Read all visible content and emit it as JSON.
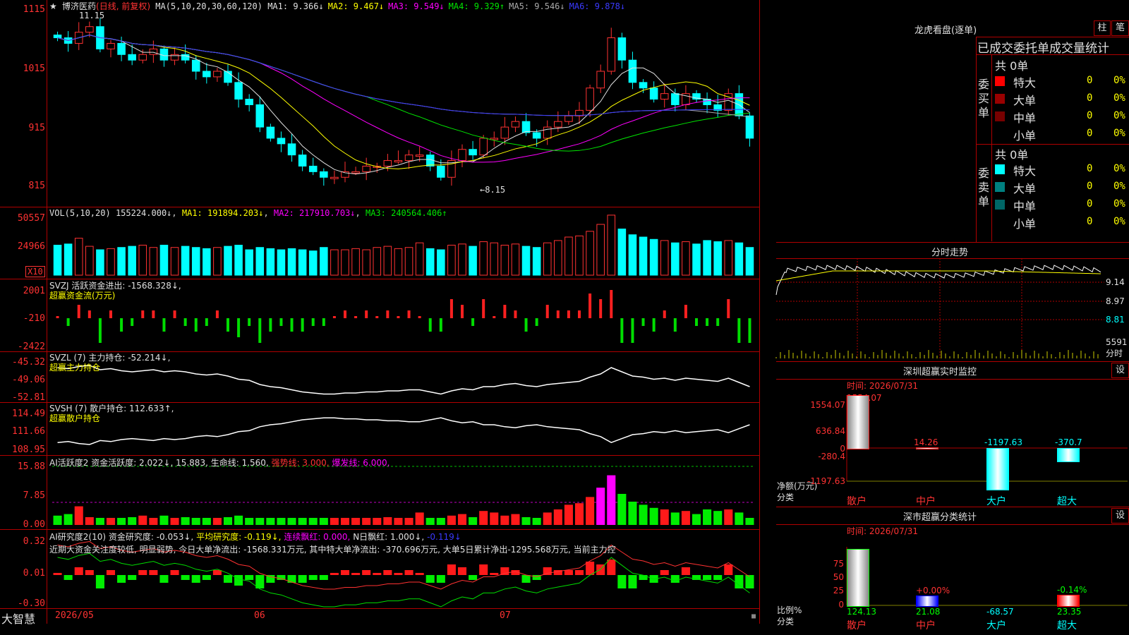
{
  "stock_header": {
    "star": "★",
    "name": "博济医药",
    "mode": "(日线, 前复权)",
    "ma_label": "MA(5,10,20,30,60,120)",
    "ma": [
      {
        "label": "MA1:",
        "val": "9.366",
        "dir": "↓",
        "color": "#e0e0e0"
      },
      {
        "label": "MA2:",
        "val": "9.467",
        "dir": "↓",
        "color": "#ffff00"
      },
      {
        "label": "MA3:",
        "val": "9.549",
        "dir": "↓",
        "color": "#ff00ff"
      },
      {
        "label": "MA4:",
        "val": "9.329",
        "dir": "↑",
        "color": "#00e600"
      },
      {
        "label": "MA5:",
        "val": "9.546",
        "dir": "↓",
        "color": "#aaaaaa"
      },
      {
        "label": "MA6:",
        "val": "9.878",
        "dir": "↓",
        "color": "#3a3aff"
      }
    ]
  },
  "price_axis": [
    "1115",
    "1015",
    "915",
    "815"
  ],
  "high_label": "11.15",
  "low_label": "←8.15",
  "vol": {
    "head": "VOL(5,10,20)",
    "v": "155224.000↓",
    "ma1": "MA1: 191894.203↓",
    "ma2": "MA2: 217910.703↓",
    "ma3": "MA3: 240564.406↑",
    "axis": [
      "50557",
      "24966"
    ],
    "unit": "X10"
  },
  "svzj": {
    "head": "SVZJ  活跃资金进出: -1568.328↓,",
    "sub": "超赢资金流(万元)",
    "axis": [
      "2001",
      "-210",
      "-2422"
    ]
  },
  "svzl": {
    "head": "SVZL (7) 主力持仓: -52.214↓,",
    "sub": "超赢主力持仓",
    "axis": [
      "-45.32",
      "-49.06",
      "-52.81"
    ]
  },
  "svsh": {
    "head": "SVSH (7) 散户持仓: 112.633↑,",
    "sub": "超赢散户持仓",
    "axis": [
      "114.49",
      "111.66",
      "108.95"
    ]
  },
  "ai2": {
    "head": "AI活跃度2 资金活跃度: 2.022↓, 15.883, 生命线: 1.560,",
    "strong": "强势线: 3.000,",
    "burst": "爆发线: 6.000,",
    "axis": [
      "15.88",
      "7.85",
      "0.00"
    ]
  },
  "ai3": {
    "head": "AI研究度2(10) 资金研究度: -0.053↓,",
    "avg": "平均研究度: -0.119↓,",
    "lx": "连续飘红: 0.000,",
    "nr": "N日飘红: 1.000↓,",
    "last": "-0.119↓",
    "axis": [
      "0.32",
      "0.01",
      "-0.30"
    ],
    "comment": "近期大资金关注度较低, 明显弱势, 今日大单净流出: -1568.331万元, 其中特大单净流出: -370.696万元, 大单5日累计净出-1295.568万元, 当前主力控"
  },
  "bottom": {
    "brand": "大智慧",
    "dates": [
      "2026/05",
      "06",
      "07"
    ]
  },
  "lhb": {
    "title": "龙虎看盘(逐单)",
    "btn1": "柱",
    "btn2": "笔",
    "tab": "已成交委托单成交量统计",
    "buy": {
      "side": "委买单",
      "total": "共 0单",
      "rows": [
        {
          "name": "特大",
          "v": "0",
          "p": "0%",
          "c": "#ff0000"
        },
        {
          "name": "大单",
          "v": "0",
          "p": "0%",
          "c": "#990000"
        },
        {
          "name": "中单",
          "v": "0",
          "p": "0%",
          "c": "#770000"
        },
        {
          "name": "小单",
          "v": "0",
          "p": "0%",
          "c": "#000000"
        }
      ]
    },
    "sell": {
      "side": "委卖单",
      "total": "共 0单",
      "rows": [
        {
          "name": "特大",
          "v": "0",
          "p": "0%",
          "c": "#00ffff"
        },
        {
          "name": "大单",
          "v": "0",
          "p": "0%",
          "c": "#008080"
        },
        {
          "name": "中单",
          "v": "0",
          "p": "0%",
          "c": "#006666"
        },
        {
          "name": "小单",
          "v": "0",
          "p": "0%",
          "c": "#000000"
        }
      ]
    }
  },
  "fenshi": {
    "title": "分时走势",
    "axis": [
      "9.14",
      "8.97",
      "8.81"
    ],
    "vol": "5591",
    "vlabel": "分时"
  },
  "monitor": {
    "title": "深圳超赢实时监控",
    "btn": "设",
    "time": "时间: 2026/07/31",
    "axis": [
      "1554.07",
      "636.84",
      "0",
      "-280.4",
      "-1197.63"
    ],
    "top": "1554.07",
    "unit": "净额(万元)",
    "cat": "分类",
    "bars": [
      {
        "name": "散户",
        "val": "1554.07"
      },
      {
        "name": "中户",
        "val": "14.26"
      },
      {
        "name": "大户",
        "val": "-1197.63"
      },
      {
        "name": "超大",
        "val": "-370.7"
      }
    ]
  },
  "classify": {
    "title": "深市超赢分类统计",
    "btn": "设",
    "time": "时间: 2026/07/31",
    "axis": [
      "75",
      "50",
      "25",
      "0"
    ],
    "unit": "比例%",
    "cat": "分类",
    "bars": [
      {
        "name": "散户",
        "val": "124.13",
        "pct": ""
      },
      {
        "name": "中户",
        "val": "21.08",
        "pct": "+0.00%"
      },
      {
        "name": "大户",
        "val": "-68.57",
        "pct": ""
      },
      {
        "name": "超大",
        "val": "23.35",
        "pct": "-0.14%"
      }
    ]
  },
  "chart_data": {
    "type": "candlestick",
    "title": "博济医药 (日线, 前复权)",
    "x_range": [
      "2026/05",
      "2026/07"
    ],
    "y_range": [
      8.15,
      11.15
    ],
    "closes": [
      10.8,
      10.7,
      10.9,
      11.0,
      10.6,
      10.7,
      10.5,
      10.4,
      10.5,
      10.6,
      10.4,
      10.5,
      10.4,
      10.2,
      10.1,
      10.2,
      10.0,
      9.7,
      9.6,
      9.2,
      9.0,
      8.9,
      8.7,
      8.5,
      8.4,
      8.3,
      8.3,
      8.4,
      8.4,
      8.5,
      8.5,
      8.6,
      8.6,
      8.7,
      8.7,
      8.5,
      8.3,
      8.6,
      8.8,
      8.7,
      9.0,
      9.0,
      9.2,
      9.3,
      9.1,
      9.0,
      9.2,
      9.3,
      9.4,
      9.5,
      9.9,
      10.2,
      10.8,
      10.4,
      10.0,
      9.9,
      9.7,
      9.8,
      9.6,
      9.8,
      9.7,
      9.6,
      9.5,
      9.8,
      9.4,
      9.0
    ],
    "volumes": [
      26,
      27,
      32,
      25,
      22,
      23,
      24,
      25,
      26,
      24,
      26,
      24,
      25,
      24,
      23,
      24,
      25,
      26,
      22,
      24,
      23,
      22,
      23,
      22,
      21,
      24,
      22,
      22,
      23,
      22,
      24,
      25,
      23,
      24,
      28,
      23,
      22,
      26,
      27,
      25,
      29,
      28,
      26,
      27,
      25,
      24,
      28,
      30,
      33,
      34,
      38,
      44,
      52,
      40,
      35,
      33,
      31,
      30,
      28,
      29,
      27,
      30,
      29,
      30,
      28,
      24
    ]
  }
}
